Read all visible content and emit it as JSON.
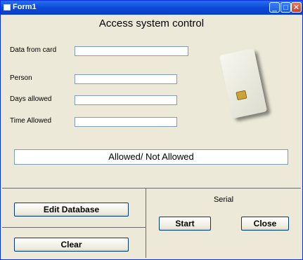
{
  "window": {
    "title": "Form1"
  },
  "heading": "Access system control",
  "fields": {
    "card_data": {
      "label": "Data from card",
      "value": ""
    },
    "person": {
      "label": "Person",
      "value": ""
    },
    "days": {
      "label": "Days allowed",
      "value": ""
    },
    "time": {
      "label": "Time Allowed",
      "value": ""
    }
  },
  "status_text": "Allowed/ Not Allowed",
  "buttons": {
    "edit_db": "Edit Database",
    "clear": "Clear",
    "start": "Start",
    "close": "Close"
  },
  "serial_label": "Serial",
  "titlebar_buttons": {
    "minimize": "_",
    "maximize": "□",
    "close": "✕"
  }
}
